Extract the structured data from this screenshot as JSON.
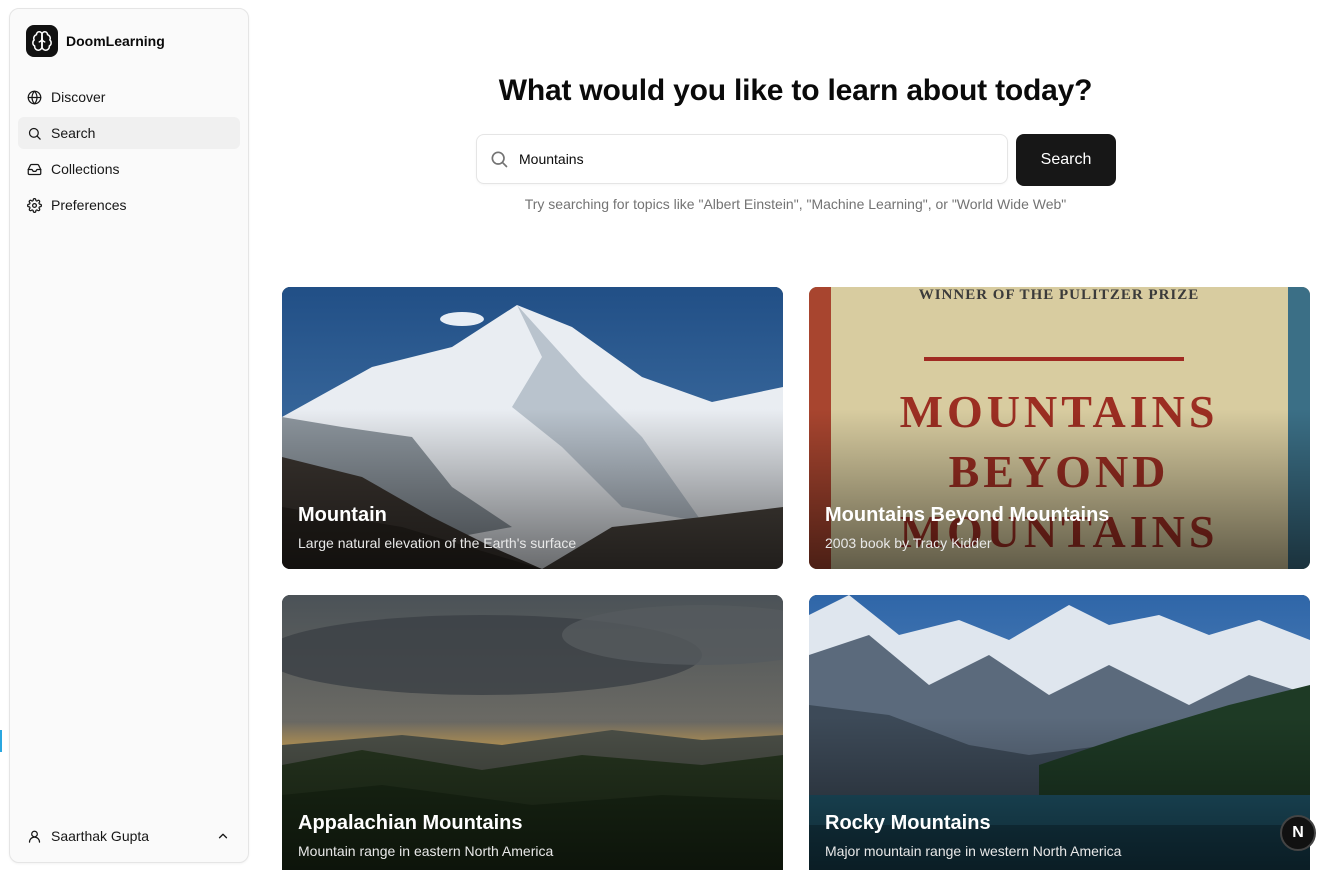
{
  "app": {
    "name": "DoomLearning",
    "logo_icon": "brain-icon"
  },
  "sidebar": {
    "items": [
      {
        "label": "Discover",
        "icon": "globe-icon"
      },
      {
        "label": "Search",
        "icon": "search-icon",
        "active": true
      },
      {
        "label": "Collections",
        "icon": "inbox-icon"
      },
      {
        "label": "Preferences",
        "icon": "gear-icon"
      }
    ],
    "user": {
      "name": "Saarthak Gupta",
      "icon": "user-icon"
    }
  },
  "main": {
    "headline": "What would you like to learn about today?",
    "search": {
      "value": "Mountains",
      "button_label": "Search"
    },
    "hint": "Try searching for topics like \"Albert Einstein\", \"Machine Learning\", or \"World Wide Web\""
  },
  "results": [
    {
      "title": "Mountain",
      "description": "Large natural elevation of the Earth's surface"
    },
    {
      "title": "Mountains Beyond Mountains",
      "description": "2003 book by Tracy Kidder",
      "cover_text": {
        "top": "WINNER OF THE PULITZER PRIZE",
        "line1": "MOUNTAINS",
        "line2": "BEYOND",
        "line3": "MOUNTAINS"
      }
    },
    {
      "title": "Appalachian Mountains",
      "description": "Mountain range in eastern North America"
    },
    {
      "title": "Rocky Mountains",
      "description": "Major mountain range in western North America"
    }
  ],
  "badge": {
    "label": "N"
  },
  "colors": {
    "primary_button": "#171717",
    "sidebar_bg": "#fafafa",
    "active_item_bg": "#f0f0f0",
    "hint_text": "#737373"
  }
}
